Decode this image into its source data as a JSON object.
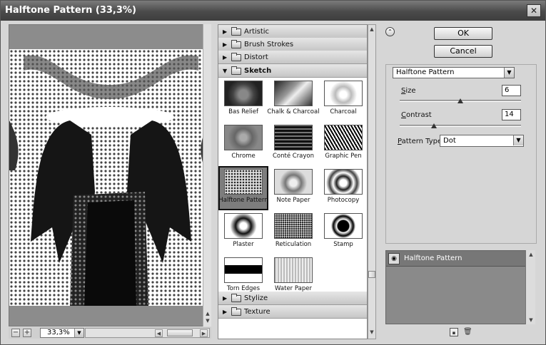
{
  "window": {
    "title": "Halftone Pattern (33,3%)",
    "close_glyph": "✕"
  },
  "preview": {
    "zoom_value": "33,3%",
    "zoom_out": "−",
    "zoom_in": "+"
  },
  "gallery": {
    "categories_top": [
      {
        "label": "Artistic",
        "open": false
      },
      {
        "label": "Brush Strokes",
        "open": false
      },
      {
        "label": "Distort",
        "open": false
      },
      {
        "label": "Sketch",
        "open": true
      }
    ],
    "sketch_filters": [
      {
        "label": "Bas Relief",
        "selected": false
      },
      {
        "label": "Chalk & Charcoal",
        "selected": false
      },
      {
        "label": "Charcoal",
        "selected": false
      },
      {
        "label": "Chrome",
        "selected": false
      },
      {
        "label": "Conté Crayon",
        "selected": false
      },
      {
        "label": "Graphic Pen",
        "selected": false
      },
      {
        "label": "Halftone Pattern",
        "selected": true
      },
      {
        "label": "Note Paper",
        "selected": false
      },
      {
        "label": "Photocopy",
        "selected": false
      },
      {
        "label": "Plaster",
        "selected": false
      },
      {
        "label": "Reticulation",
        "selected": false
      },
      {
        "label": "Stamp",
        "selected": false
      },
      {
        "label": "Torn Edges",
        "selected": false
      },
      {
        "label": "Water Paper",
        "selected": false
      }
    ],
    "categories_bottom": [
      {
        "label": "Stylize",
        "open": false
      },
      {
        "label": "Texture",
        "open": false
      }
    ]
  },
  "actions": {
    "ok_label": "OK",
    "cancel_label": "Cancel"
  },
  "settings": {
    "filter_select": "Halftone Pattern",
    "size_label_first": "S",
    "size_label_rest": "ize",
    "size_value": "6",
    "size_level": 0.5,
    "contrast_label_first": "C",
    "contrast_label_rest": "ontrast",
    "contrast_value": "14",
    "contrast_level": 0.28,
    "pattern_type_label_first": "P",
    "pattern_type_label_rest": "attern Type:",
    "pattern_type_value": "Dot"
  },
  "layers": {
    "items": [
      {
        "name": "Halftone Pattern",
        "visible": true
      }
    ]
  },
  "icons": {
    "close": "close-icon",
    "collapse": "collapse-chevron-icon",
    "dropdown": "dropdown-arrow-icon",
    "eye": "eye-icon",
    "new_layer": "new-layer-icon",
    "delete_layer": "trash-icon"
  }
}
